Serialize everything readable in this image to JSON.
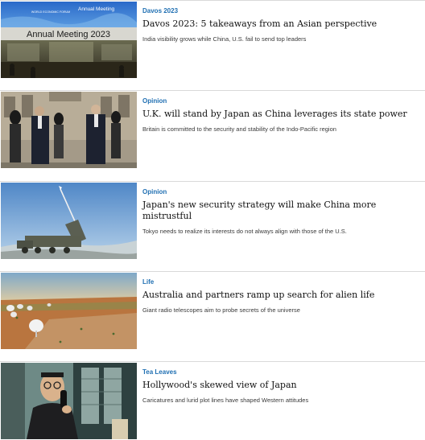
{
  "articles": [
    {
      "kicker": "Davos 2023",
      "headline": "Davos 2023: 5 takeaways from an Asian perspective",
      "summary": "India visibility grows while China, U.S. fail to send top leaders",
      "image_label": "davos-annual-meeting-photo",
      "image_text": {
        "forum_name": "WORLD ECONOMIC FORUM",
        "meeting_label": "Annual Meeting",
        "banner": "Annual Meeting 2023"
      }
    },
    {
      "kicker": "Opinion",
      "headline": "U.K. will stand by Japan as China leverages its state power",
      "summary": "Britain is committed to the security and stability of the Indo-Pacific region",
      "image_label": "leaders-honor-guard-photo"
    },
    {
      "kicker": "Opinion",
      "headline": "Japan's new security strategy will make China more mistrustful",
      "summary": "Tokyo needs to realize its interests do not always align with those of the U.S.",
      "image_label": "missile-launch-photo"
    },
    {
      "kicker": "Life",
      "headline": "Australia and partners ramp up search for alien life",
      "summary": "Giant radio telescopes aim to probe secrets of the universe",
      "image_label": "radio-telescopes-photo"
    },
    {
      "kicker": "Tea Leaves",
      "headline": "Hollywood's skewed view of Japan",
      "summary": "Caricatures and lurid plot lines have shaped Western attitudes",
      "image_label": "film-still-telephone-photo"
    }
  ],
  "colors": {
    "kicker": "#1f6fb2",
    "headline": "#111111",
    "summary": "#3a3a3a",
    "divider": "#d9d9d9"
  }
}
